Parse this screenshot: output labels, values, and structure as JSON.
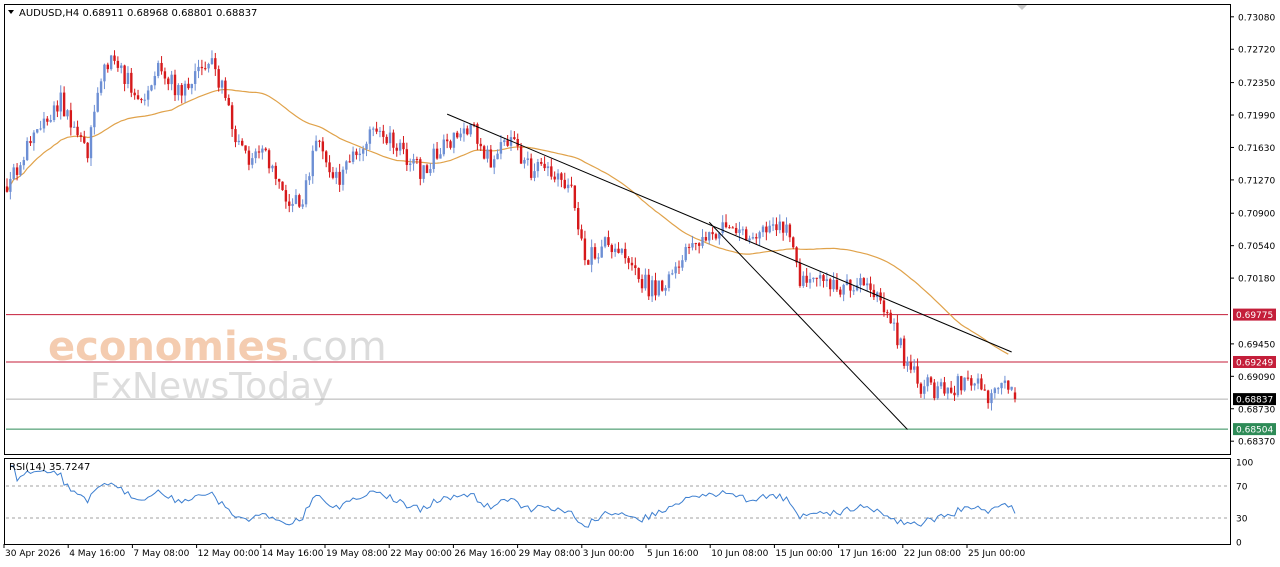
{
  "header": {
    "symbol_line": "AUDUSD,H4  0.68911 0.68968 0.68801 0.68837"
  },
  "rsi_header": {
    "label": "RSI(14) 35.7247"
  },
  "watermark": {
    "brand_a": "economies",
    "brand_b": ".com",
    "brand_c": "FxNewsToday"
  },
  "colors": {
    "bull": "#6d8fd4",
    "bear": "#d6191b",
    "ma": "#e0a24a",
    "resistance": "#c41e3a",
    "support": "#2e8b57",
    "price_tag": "#000000",
    "rsi": "#3d7fd0"
  },
  "chart_data": {
    "type": "candlestick",
    "symbol": "AUDUSD",
    "timeframe": "H4",
    "ohlc_header": {
      "open": 0.68911,
      "high": 0.68968,
      "low": 0.68801,
      "close": 0.68837
    },
    "price_axis": {
      "ticks": [
        0.7308,
        0.7272,
        0.7235,
        0.7199,
        0.7163,
        0.7127,
        0.709,
        0.7054,
        0.7018,
        0.6945,
        0.6909,
        0.6873,
        0.6837
      ],
      "ylim": [
        0.6825,
        0.732
      ]
    },
    "x_axis": {
      "labels": [
        "30 Apr 2026",
        "4 May 16:00",
        "7 May 08:00",
        "12 May 00:00",
        "14 May 16:00",
        "19 May 08:00",
        "22 May 00:00",
        "26 May 16:00",
        "29 May 08:00",
        "3 Jun 00:00",
        "5 Jun 16:00",
        "10 Jun 08:00",
        "15 Jun 00:00",
        "17 Jun 16:00",
        "22 Jun 08:00",
        "25 Jun 00:00"
      ]
    },
    "levels": [
      {
        "value": 0.69775,
        "label": "0.69775",
        "kind": "resistance"
      },
      {
        "value": 0.69249,
        "label": "0.69249",
        "kind": "resistance"
      },
      {
        "value": 0.68837,
        "label": "0.68837",
        "kind": "current"
      },
      {
        "value": 0.68504,
        "label": "0.68504",
        "kind": "support"
      }
    ],
    "series": [
      {
        "type": "ohlc",
        "anchors": [
          [
            0,
            0.712
          ],
          [
            6,
            0.716
          ],
          [
            12,
            0.7195
          ],
          [
            16,
            0.7215
          ],
          [
            20,
            0.7175
          ],
          [
            24,
            0.7155
          ],
          [
            28,
            0.7245
          ],
          [
            32,
            0.7265
          ],
          [
            36,
            0.7235
          ],
          [
            40,
            0.7215
          ],
          [
            44,
            0.725
          ],
          [
            48,
            0.7242
          ],
          [
            52,
            0.722
          ],
          [
            56,
            0.7245
          ],
          [
            60,
            0.726
          ],
          [
            64,
            0.723
          ],
          [
            68,
            0.7175
          ],
          [
            72,
            0.7145
          ],
          [
            76,
            0.716
          ],
          [
            80,
            0.7125
          ],
          [
            84,
            0.7095
          ],
          [
            88,
            0.711
          ],
          [
            92,
            0.7165
          ],
          [
            96,
            0.714
          ],
          [
            100,
            0.713
          ],
          [
            104,
            0.716
          ],
          [
            108,
            0.7175
          ],
          [
            112,
            0.7172
          ],
          [
            116,
            0.7168
          ],
          [
            120,
            0.715
          ],
          [
            124,
            0.7135
          ],
          [
            128,
            0.716
          ],
          [
            132,
            0.717
          ],
          [
            136,
            0.719
          ],
          [
            140,
            0.7175
          ],
          [
            144,
            0.7145
          ],
          [
            148,
            0.718
          ],
          [
            152,
            0.716
          ],
          [
            156,
            0.714
          ],
          [
            160,
            0.7135
          ],
          [
            164,
            0.713
          ],
          [
            168,
            0.7125
          ],
          [
            172,
            0.704
          ],
          [
            176,
            0.705
          ],
          [
            180,
            0.7055
          ],
          [
            184,
            0.7045
          ],
          [
            188,
            0.702
          ],
          [
            192,
            0.7005
          ],
          [
            196,
            0.7008
          ],
          [
            200,
            0.704
          ],
          [
            204,
            0.7055
          ],
          [
            208,
            0.706
          ],
          [
            212,
            0.7075
          ],
          [
            216,
            0.707
          ],
          [
            220,
            0.707
          ],
          [
            224,
            0.7065
          ],
          [
            228,
            0.707
          ],
          [
            232,
            0.7075
          ],
          [
            236,
            0.701
          ],
          [
            240,
            0.7025
          ],
          [
            244,
            0.7015
          ],
          [
            248,
            0.7008
          ],
          [
            252,
            0.7015
          ],
          [
            256,
            0.7005
          ],
          [
            260,
            0.699
          ],
          [
            264,
            0.696
          ],
          [
            268,
            0.692
          ],
          [
            272,
            0.69
          ],
          [
            276,
            0.6895
          ],
          [
            280,
            0.6895
          ],
          [
            284,
            0.69
          ],
          [
            288,
            0.69
          ],
          [
            292,
            0.689
          ],
          [
            296,
            0.6905
          ],
          [
            300,
            0.6884
          ]
        ]
      },
      {
        "name": "MA",
        "type": "line",
        "key": "moving_average"
      }
    ],
    "trendlines": [
      {
        "from": [
          131,
          0.72
        ],
        "to": [
          299,
          0.6936
        ]
      },
      {
        "from": [
          209,
          0.708
        ],
        "to": [
          268,
          0.685
        ]
      }
    ],
    "rsi": {
      "label": "RSI(14)",
      "current": 35.7247,
      "ylim": [
        0,
        100
      ],
      "levels": [
        70,
        30
      ],
      "ticks": [
        100,
        70,
        30,
        0
      ]
    }
  }
}
